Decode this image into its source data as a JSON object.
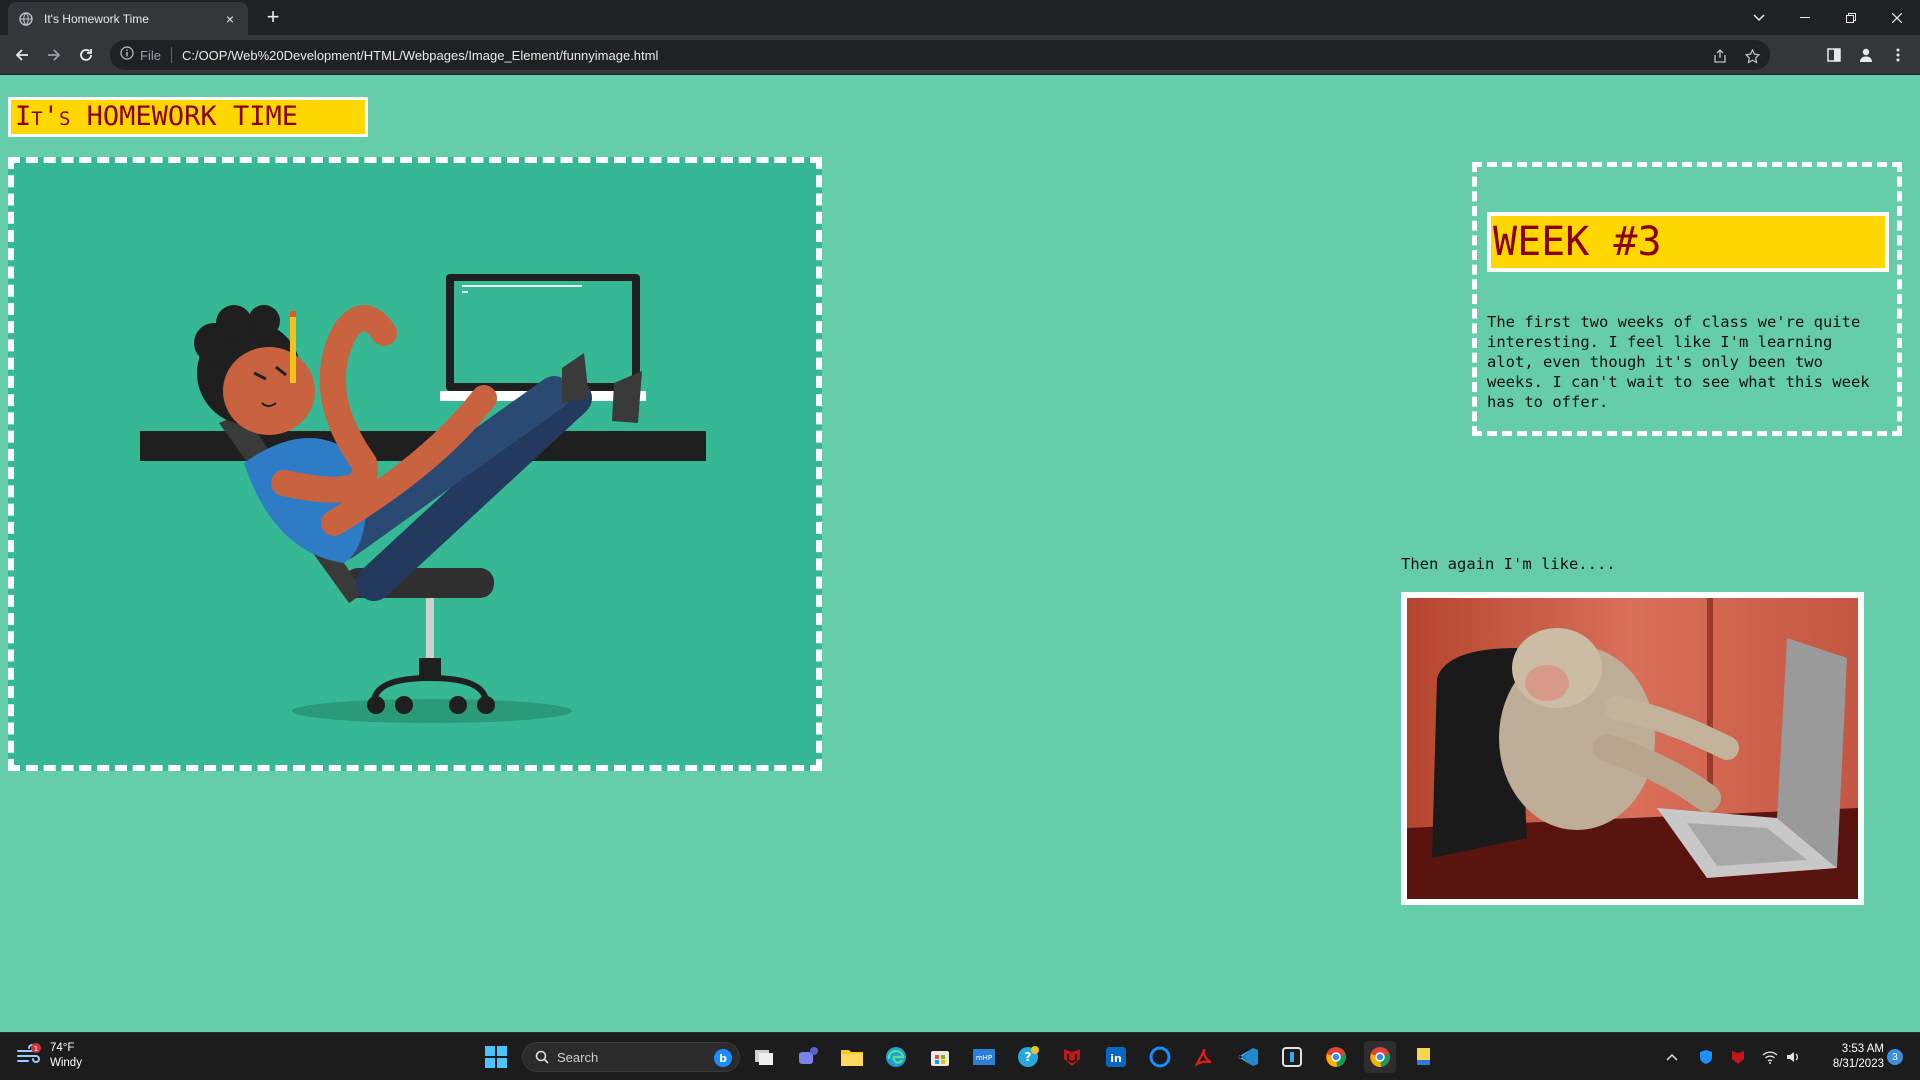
{
  "browser": {
    "tab_title": "It's Homework Time",
    "tab_close": "×",
    "new_tab": "+",
    "scheme_label": "File",
    "url": "C:/OOP/Web%20Development/HTML/Webpages/Image_Element/funnyimage.html"
  },
  "page": {
    "heading": "It's HOMEWORK TIME",
    "week_title": "WEEK #3",
    "week_text": "The first two weeks of class we're quite interesting. I feel like I'm learning alot, even though it's only been two weeks. I can't wait to see what this week has to offer.",
    "caption": "Then again I'm like...."
  },
  "taskbar": {
    "weather_temp": "74°F",
    "weather_cond": "Windy",
    "search_placeholder": "Search",
    "time": "3:53 AM",
    "date": "8/31/2023",
    "notif_count": "3"
  },
  "colors": {
    "page_bg": "#66cdaa",
    "heading_bg": "#ffd700",
    "heading_text": "#8b0000",
    "hero_bg": "#35b893"
  }
}
